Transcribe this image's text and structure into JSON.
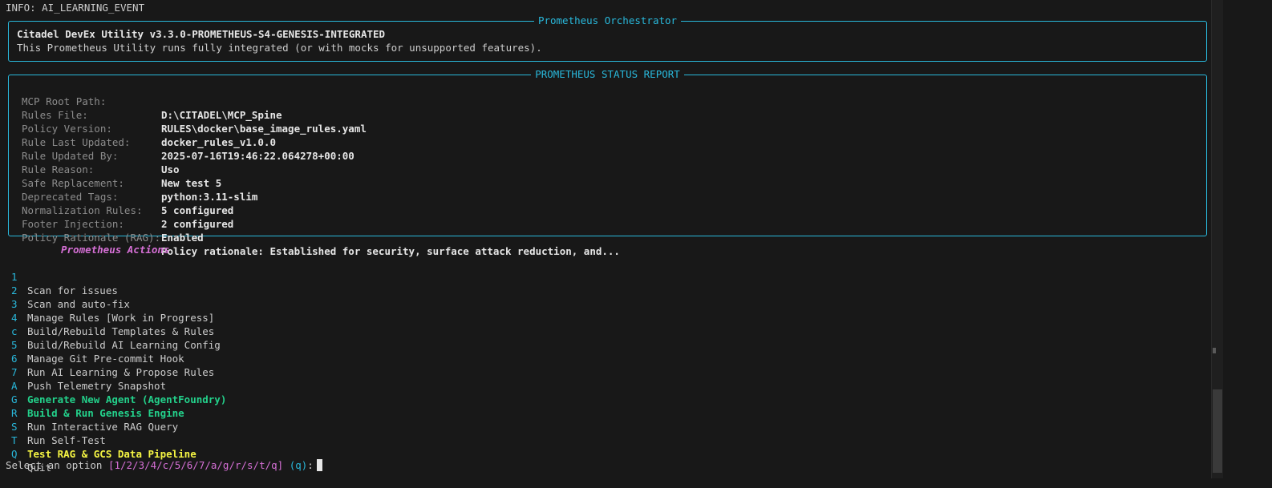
{
  "info_line": "INFO: AI_LEARNING_EVENT",
  "orchestrator_panel": {
    "title": "Prometheus Orchestrator",
    "heading": "Citadel DevEx Utility v3.3.0-PROMETHEUS-S4-GENESIS-INTEGRATED",
    "description": "This Prometheus Utility runs fully integrated (or with mocks for unsupported features)."
  },
  "status_panel": {
    "title": "PROMETHEUS STATUS REPORT",
    "rows": [
      {
        "key": "MCP Root Path:",
        "value": "D:\\CITADEL\\MCP_Spine"
      },
      {
        "key": "Rules File:",
        "value": "RULES\\docker\\base_image_rules.yaml"
      },
      {
        "key": "Policy Version:",
        "value": "docker_rules_v1.0.0"
      },
      {
        "key": "Rule Last Updated:",
        "value": "2025-07-16T19:46:22.064278+00:00"
      },
      {
        "key": "Rule Updated By:",
        "value": "Uso"
      },
      {
        "key": "Rule Reason:",
        "value": "New test 5"
      },
      {
        "key": "Safe Replacement:",
        "value": "python:3.11-slim"
      },
      {
        "key": "Deprecated Tags:",
        "value": "5 configured"
      },
      {
        "key": "Normalization Rules:",
        "value": "2 configured"
      },
      {
        "key": "Footer Injection:",
        "value": "Enabled"
      },
      {
        "key": "Policy Rationale (RAG):",
        "value": "Policy rationale: Established for security, surface attack reduction, and..."
      }
    ]
  },
  "menu": {
    "title": "Prometheus Actions",
    "items": [
      {
        "key": "1",
        "label": "Scan for issues",
        "style": "normal"
      },
      {
        "key": "2",
        "label": "Scan and auto-fix",
        "style": "normal"
      },
      {
        "key": "3",
        "label": "Manage Rules [Work in Progress]",
        "style": "normal"
      },
      {
        "key": "4",
        "label": "Build/Rebuild Templates & Rules",
        "style": "normal"
      },
      {
        "key": "c",
        "label": "Build/Rebuild AI Learning Config",
        "style": "normal"
      },
      {
        "key": "5",
        "label": "Manage Git Pre-commit Hook",
        "style": "normal"
      },
      {
        "key": "6",
        "label": "Run AI Learning & Propose Rules",
        "style": "normal"
      },
      {
        "key": "7",
        "label": "Push Telemetry Snapshot",
        "style": "normal"
      },
      {
        "key": "A",
        "label": "Generate New Agent (AgentFoundry)",
        "style": "green"
      },
      {
        "key": "G",
        "label": "Build & Run Genesis Engine",
        "style": "green"
      },
      {
        "key": "R",
        "label": "Run Interactive RAG Query",
        "style": "normal"
      },
      {
        "key": "S",
        "label": "Run Self-Test",
        "style": "normal"
      },
      {
        "key": "T",
        "label": "Test RAG & GCS Data Pipeline",
        "style": "yellow"
      },
      {
        "key": "Q",
        "label": "Quit",
        "style": "normal"
      }
    ]
  },
  "prompt": {
    "text": "Select an option ",
    "options": "[1/2/3/4/c/5/6/7/a/g/r/s/t/q]",
    "default": "(q)",
    "suffix": ":"
  },
  "colors": {
    "accent_cyan": "#29b8db",
    "magenta": "#d670d6",
    "green": "#23d18b",
    "yellow": "#f5f543",
    "background": "#181818"
  }
}
